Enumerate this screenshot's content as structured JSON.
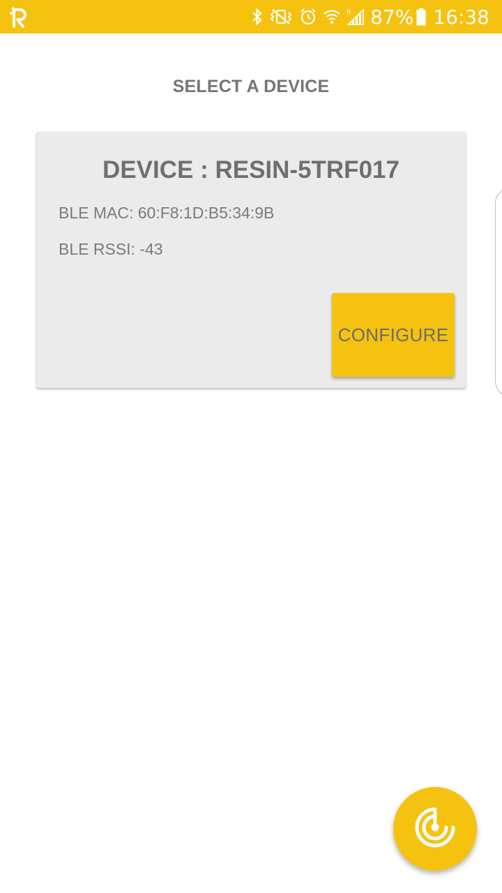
{
  "status_bar": {
    "app_icon": "resin-R-icon",
    "icons": [
      "bluetooth-icon",
      "vibrate-icon",
      "alarm-icon",
      "wifi-icon",
      "signal-icon"
    ],
    "battery_percent": "87%",
    "battery_level": 0.87,
    "time": "16:38",
    "background_color": "#F5C210"
  },
  "page": {
    "title": "SELECT A DEVICE"
  },
  "device_card": {
    "title": "DEVICE : RESIN-5TRF017",
    "mac_line": "BLE MAC: 60:F8:1D:B5:34:9B",
    "rssi_line": "BLE RSSI: -43",
    "configure_label": "CONFIGURE",
    "accent_color": "#F5C210"
  },
  "fab": {
    "icon": "scan-radar-icon"
  }
}
